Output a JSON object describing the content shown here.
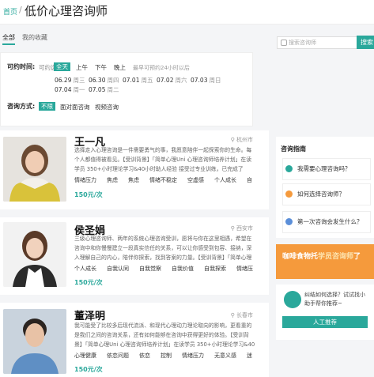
{
  "header": {
    "breadcrumb_home": "首页",
    "separator": "/",
    "title": "低价心理咨询师"
  },
  "tabs": [
    {
      "label": "全部"
    },
    {
      "label": "我的收藏"
    }
  ],
  "search": {
    "placeholder": "搜索咨询师",
    "button": "搜索"
  },
  "filters": {
    "time_label": "可约时间:",
    "time_options": [
      "可约选",
      "全天",
      "上午",
      "下午",
      "晚上"
    ],
    "time_hint": "最早可预约24小时以后",
    "dates": [
      {
        "date": "06.29",
        "weekday": "周三"
      },
      {
        "date": "06.30",
        "weekday": "周四"
      },
      {
        "date": "07.01",
        "weekday": "周五"
      },
      {
        "date": "07.02",
        "weekday": "周六"
      },
      {
        "date": "07.03",
        "weekday": "周日"
      },
      {
        "date": "07.04",
        "weekday": "周一"
      },
      {
        "date": "07.05",
        "weekday": "周二"
      }
    ],
    "method_label": "咨询方式:",
    "method_options": [
      "不限",
      "面对面咨询",
      "视频咨询"
    ]
  },
  "counselors": [
    {
      "name": "王一凡",
      "location": "杭州市",
      "desc": "选择走入心理咨询是一件需要勇气的事，我愿意陪伴一起探索你的生命。每个人都值得被看见。【受训背景】「简单心理Uni 心理咨询师培养计划」在读学员 350+小时理论学习&40小时助人经验 接受过专业训练，已完成了",
      "tags": [
        "情绪压力",
        "焦虑",
        "焦虑",
        "情绪不稳定",
        "空虚感",
        "个人成长",
        "自"
      ],
      "price": "150元/次"
    },
    {
      "name": "侯圣娟",
      "location": "西安市",
      "desc": "三级心理咨询师、两年的系统心理咨询受训，愿将与你在这里相遇，希望在咨询中和你慢慢建立一段真实信任的关系，可以让你感受到包容、接纳，深入理解自己的内心，陪伴你探索，找到答案的力量。【受训背景】「简单心理Uni",
      "tags": [
        "个人成长",
        "自我认同",
        "自我觉察",
        "自我价值",
        "自我探索",
        "情绪压"
      ],
      "price": "150元/次"
    },
    {
      "name": "董泽明",
      "location": "长春市",
      "desc": "我可能受了比较多后现代流派、和现代心理动力理论取向的影响，更看重的是我们之间的咨询关系，还有如何能够在咨询中获得更好的体验。【受训背景】「简单心理Uni 心理咨询师培养计划」在读学员 350+小时理论学习&40",
      "tags": [
        "心理健康",
        "依恋问题",
        "依恋",
        "控制",
        "情绪压力",
        "无意义感",
        "迷"
      ],
      "price": "150元/次"
    }
  ],
  "sidebar": {
    "guide_title": "咨询指南",
    "questions": [
      "我需要心理咨询吗？",
      "如何选择咨询师？",
      "第一次咨询会发生什么？"
    ],
    "banner_pre": "咖啡食物托",
    "banner_em": "学员咨询师",
    "banner_post": "了",
    "help_text": "纠结如何选择？试试找小助手帮你推荐~",
    "help_button": "人工推荐"
  },
  "colors": {
    "accent": "#2aa89b",
    "banner": "#f59a3c"
  }
}
